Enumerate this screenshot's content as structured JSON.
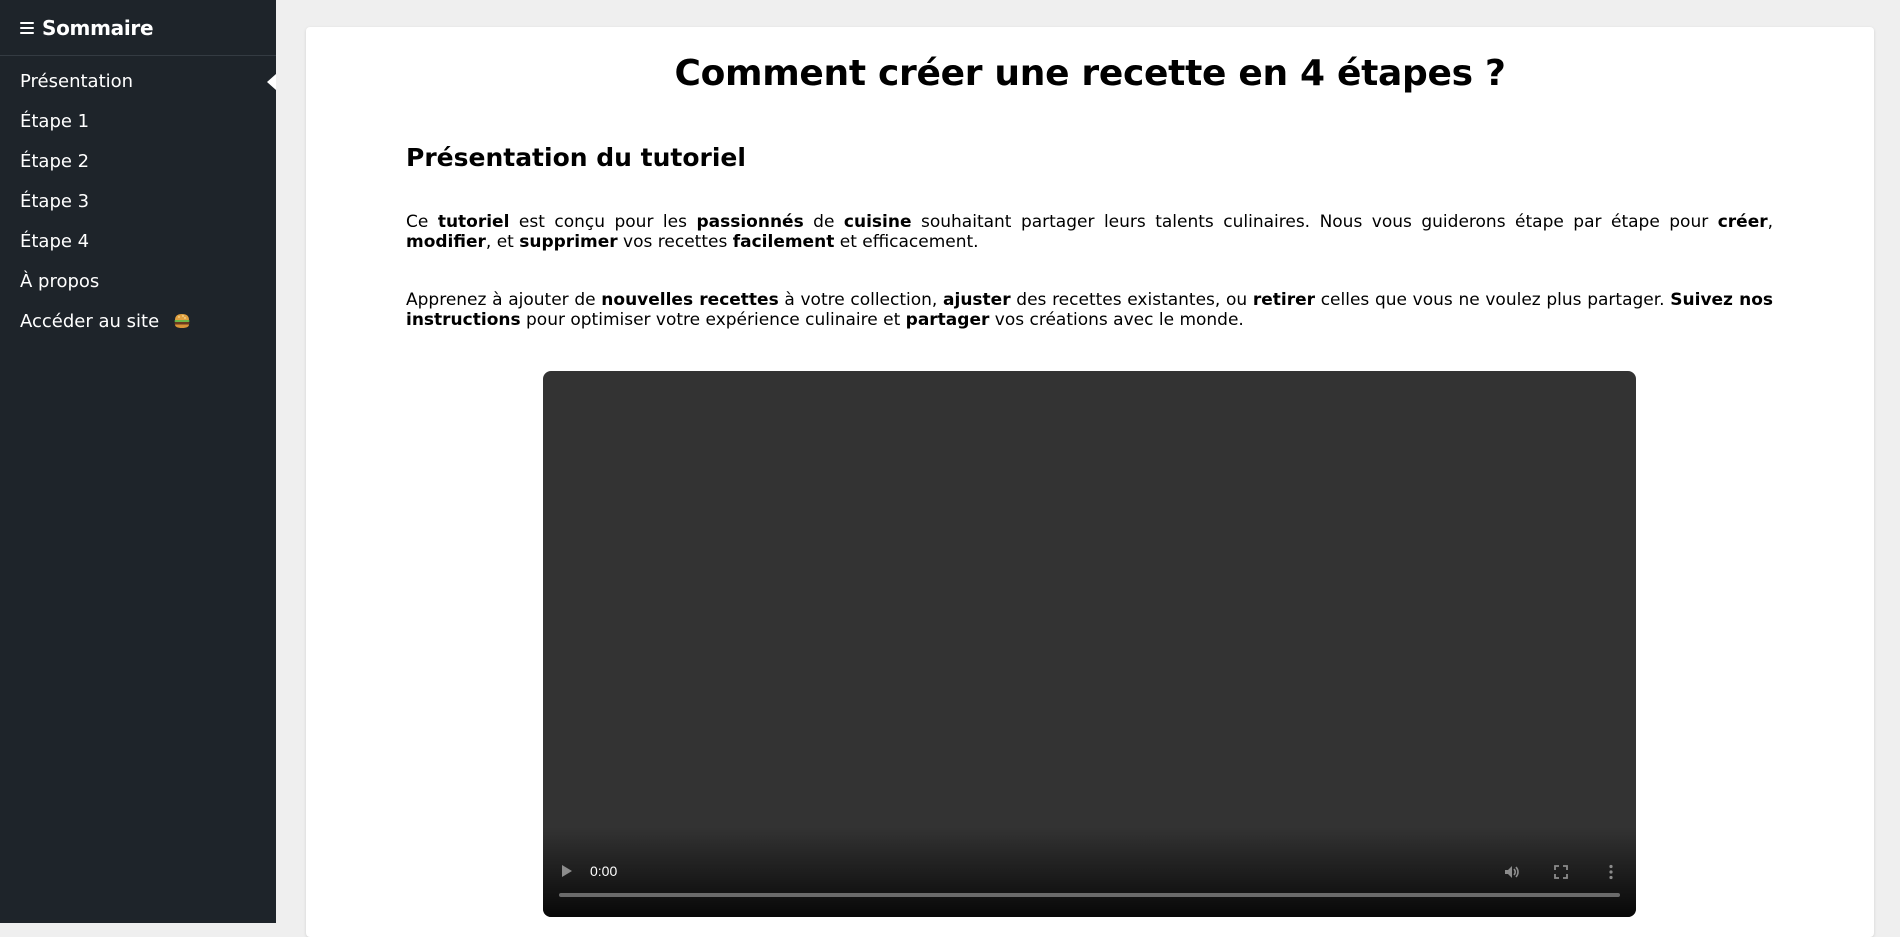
{
  "sidebar": {
    "title": "Sommaire",
    "items": [
      {
        "label": "Présentation"
      },
      {
        "label": "Étape 1"
      },
      {
        "label": "Étape 2"
      },
      {
        "label": "Étape 3"
      },
      {
        "label": "Étape 4"
      },
      {
        "label": "À propos"
      },
      {
        "label": "Accéder au site",
        "icon": "burger-emoji-icon"
      }
    ],
    "active_item": "Présentation",
    "colors": {
      "background": "#1e242a",
      "text": "#ffffff"
    }
  },
  "main": {
    "title": "Comment créer une recette en 4 étapes ?",
    "section_title": "Présentation du tutoriel",
    "paragraph1": {
      "t1": "Ce ",
      "b1": "tutoriel",
      "t2": " est conçu pour les ",
      "b2": "passionnés",
      "t3": " de ",
      "b3": "cuisine",
      "t4": " souhaitant partager leurs talents culinaires. Nous vous guiderons étape par étape pour ",
      "b4": "créer",
      "t5": ", ",
      "b5": "modifier",
      "t6": ", et ",
      "b6": "supprimer",
      "t7": " vos recettes ",
      "b7": "facilement",
      "t8": " et efficacement."
    },
    "paragraph2": {
      "t1": "Apprenez à ajouter de ",
      "b1": "nouvelles recettes",
      "t2": " à votre collection, ",
      "b2": "ajuster",
      "t3": " des recettes existantes, ou ",
      "b3": "retirer",
      "t4": " celles que vous ne voulez plus partager. ",
      "b4": "Suivez nos instructions",
      "t5": " pour optimiser votre expérience culinaire et ",
      "b5": "partager",
      "t6": " vos créations avec le monde."
    },
    "video": {
      "time": "0:00",
      "progress": 0,
      "controls": [
        "play-icon",
        "volume-icon",
        "fullscreen-icon",
        "more-options-icon"
      ]
    }
  }
}
